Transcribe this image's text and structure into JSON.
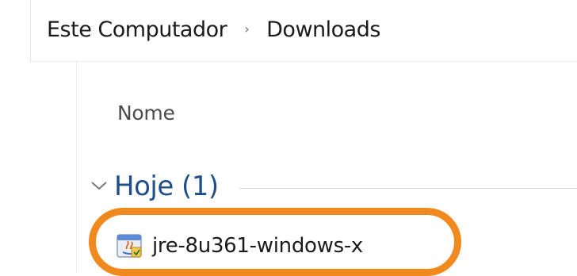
{
  "breadcrumb": {
    "items": [
      "Este Computador",
      "Downloads"
    ],
    "separator": "›"
  },
  "file_list": {
    "column_header": "Nome",
    "group": {
      "label": "Hoje (1)",
      "expanded": true
    },
    "files": [
      {
        "name": "jre-8u361-windows-x",
        "icon": "java-installer-icon"
      }
    ]
  },
  "annotation": {
    "highlight_color": "#f18a1e",
    "target": "jre-8u361-windows-x"
  },
  "colors": {
    "group_label": "#1f4e8c",
    "text": "#1b1b1b",
    "muted_text": "#4c4c4c"
  }
}
